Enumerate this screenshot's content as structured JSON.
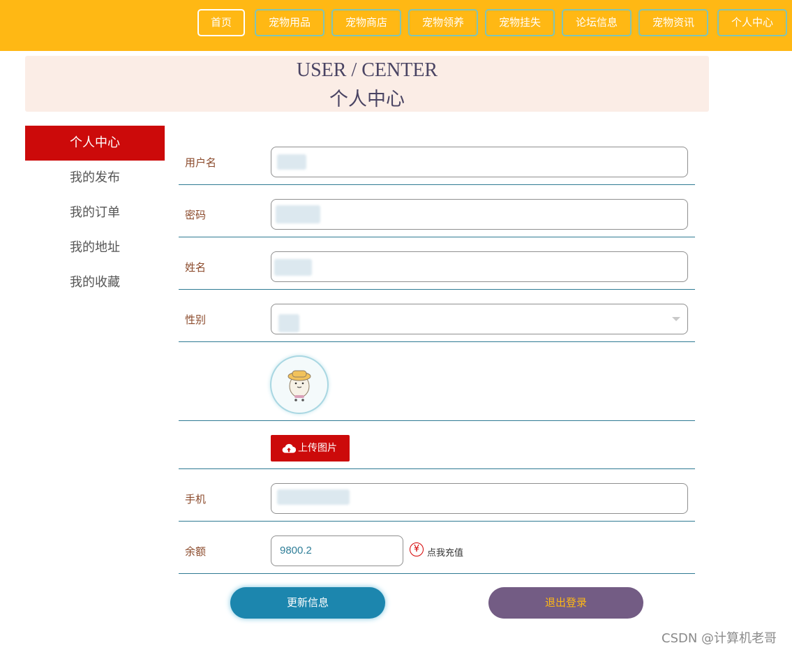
{
  "nav": {
    "items": [
      "首页",
      "宠物用品",
      "宠物商店",
      "宠物领养",
      "宠物挂失",
      "论坛信息",
      "宠物资讯",
      "个人中心"
    ]
  },
  "banner": {
    "title_en": "USER / CENTER",
    "title_zh": "个人中心"
  },
  "sidebar": {
    "items": [
      "个人中心",
      "我的发布",
      "我的订单",
      "我的地址",
      "我的收藏"
    ],
    "active_index": 0
  },
  "form": {
    "username_label": "用户名",
    "password_label": "密码",
    "name_label": "姓名",
    "gender_label": "性别",
    "phone_label": "手机",
    "balance_label": "余额",
    "balance_value": "9800.2",
    "upload_label": "上传图片",
    "recharge_label": "点我充值",
    "yen_symbol": "¥"
  },
  "actions": {
    "update_label": "更新信息",
    "logout_label": "退出登录"
  },
  "watermark": "CSDN @计算机老哥",
  "colors": {
    "topbar": "#FFB814",
    "primary_red": "#CC0A0A",
    "update_blue": "#1C86AE",
    "logout_purple": "#735C84",
    "banner_bg": "#FBEDE6"
  }
}
